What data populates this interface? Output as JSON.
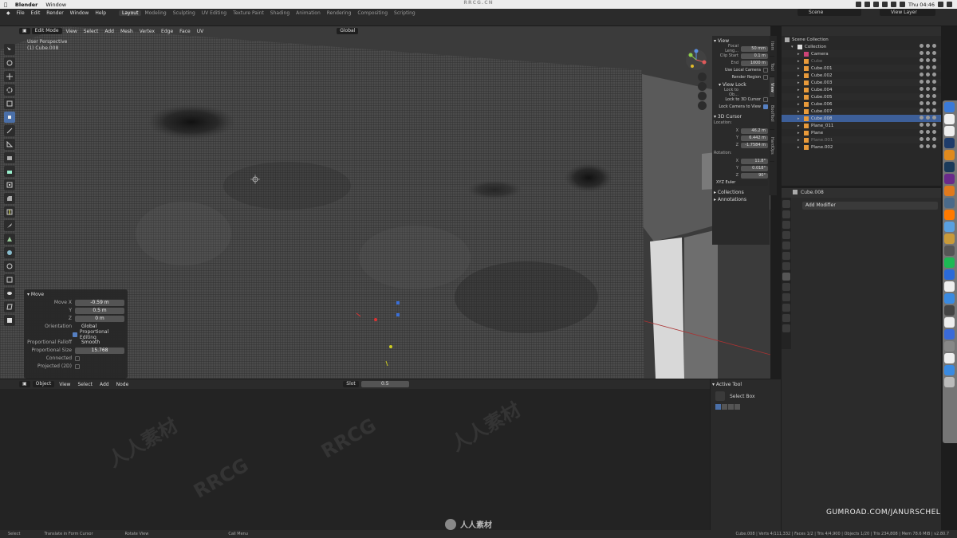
{
  "mac_menubar": {
    "apple": "",
    "app_name": "Blender",
    "menu_window": "Window",
    "watermark": "RRCG.CN",
    "clock": "Thu 04:46",
    "battery_count": "2"
  },
  "blender_menu": {
    "items": [
      "File",
      "Edit",
      "Render",
      "Window",
      "Help"
    ],
    "workspaces": [
      "Layout",
      "Modeling",
      "Sculpting",
      "UV Editing",
      "Texture Paint",
      "Shading",
      "Animation",
      "Rendering",
      "Compositing",
      "Scripting"
    ],
    "active_workspace": "Layout",
    "scene_label": "Scene",
    "view_layer_label": "View Layer"
  },
  "viewport": {
    "mode": "Edit Mode",
    "menus": [
      "View",
      "Select",
      "Add",
      "Mesh",
      "Vertex",
      "Edge",
      "Face",
      "UV"
    ],
    "orientation": "Global",
    "info_line1": "User Perspective",
    "info_line2": "(1) Cube.008"
  },
  "operator_panel": {
    "title": "Move",
    "move_x_label": "Move X",
    "move_x": "-0.59 m",
    "y_label": "Y",
    "y": "0.5 m",
    "z_label": "Z",
    "z": "0 m",
    "orientation_label": "Orientation",
    "orientation": "Global",
    "prop_edit_label": "Proportional Editing",
    "prop_falloff_label": "Proportional Falloff",
    "prop_falloff": "Smooth",
    "prop_size_label": "Proportional Size",
    "prop_size": "15.768",
    "connected_label": "Connected",
    "projected_label": "Projected (2D)"
  },
  "n_panel": {
    "view_section": "View",
    "focal_label": "Focal Leng...",
    "focal": "50 mm",
    "clip_start_label": "Clip Start",
    "clip_start": "0.1 m",
    "clip_end_label": "End",
    "clip_end": "1000 m",
    "use_local_camera": "Use Local Camera",
    "render_region": "Render Region",
    "view_lock": "View Lock",
    "lock_to_object": "Lock to Ob...",
    "lock_to_3d_cursor": "Lock to 3D Cursor",
    "lock_camera_to_view": "Lock Camera to View",
    "cursor_section": "3D Cursor",
    "location_label": "Location:",
    "loc_x": "46.2 m",
    "loc_y": "6.442 m",
    "loc_z": "-1.7584 m",
    "rotation_label": "Rotation:",
    "rot_x": "11.8°",
    "rot_y": "0.018°",
    "rot_z": "90°",
    "rot_mode": "XYZ Euler",
    "collections": "Collections",
    "annotations": "Annotations",
    "tabs": [
      "Item",
      "Tool",
      "View",
      "BoolTool",
      "HardOps"
    ]
  },
  "outliner": {
    "root": "Scene Collection",
    "rows": [
      {
        "name": "Collection",
        "indent": 1,
        "dim": false,
        "sel": false
      },
      {
        "name": "Camera",
        "indent": 2,
        "dim": false,
        "sel": false
      },
      {
        "name": "Cube",
        "indent": 2,
        "dim": true,
        "sel": false
      },
      {
        "name": "Cube.001",
        "indent": 2,
        "dim": false,
        "sel": false
      },
      {
        "name": "Cube.002",
        "indent": 2,
        "dim": false,
        "sel": false
      },
      {
        "name": "Cube.003",
        "indent": 2,
        "dim": false,
        "sel": false
      },
      {
        "name": "Cube.004",
        "indent": 2,
        "dim": false,
        "sel": false
      },
      {
        "name": "Cube.005",
        "indent": 2,
        "dim": false,
        "sel": false
      },
      {
        "name": "Cube.006",
        "indent": 2,
        "dim": false,
        "sel": false
      },
      {
        "name": "Cube.007",
        "indent": 2,
        "dim": false,
        "sel": false
      },
      {
        "name": "Cube.008",
        "indent": 2,
        "dim": false,
        "sel": true
      },
      {
        "name": "Plane_011",
        "indent": 2,
        "dim": false,
        "sel": false
      },
      {
        "name": "Plane",
        "indent": 2,
        "dim": false,
        "sel": false
      },
      {
        "name": "Plane.001",
        "indent": 2,
        "dim": true,
        "sel": false
      },
      {
        "name": "Plane.002",
        "indent": 2,
        "dim": false,
        "sel": false
      }
    ]
  },
  "properties": {
    "object_name": "Cube.008",
    "add_modifier": "Add Modifier"
  },
  "bottom_editor": {
    "mode": "Object",
    "menus": [
      "View",
      "Select",
      "Add",
      "Node"
    ],
    "slot": "Slot",
    "value": "0.5"
  },
  "active_tool": {
    "section": "Active Tool",
    "tool_name": "Select Box"
  },
  "status_bar": {
    "select": "Select",
    "box_select": "Translate in Form Cursor",
    "rotate": "Rotate View",
    "call_menu": "Call Menu",
    "stats": "Cube.008 | Verts 4/111,332 | Faces 1/2 | Tris 4/4,900 | Objects 1/20 | Tris 234,808 | Mem 78.6 MiB | v2.80.7"
  },
  "overlay": {
    "gumroad": "GUMROAD.COM/JANURSCHEL",
    "cn_brand": "人人素材"
  }
}
